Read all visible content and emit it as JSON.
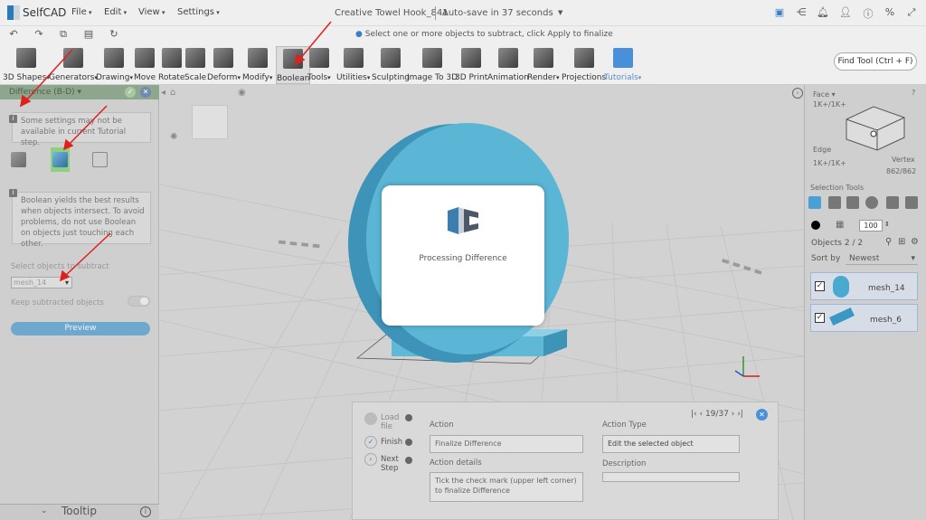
{
  "app": {
    "name": "SelfCAD"
  },
  "menu": [
    {
      "label": "File"
    },
    {
      "label": "Edit"
    },
    {
      "label": "View"
    },
    {
      "label": "Settings"
    }
  ],
  "project": {
    "title": "Creative Towel Hook_841",
    "autosave": "Auto-save in 37 seconds"
  },
  "hint": "Select one or more objects to subtract, click Apply to finalize",
  "toolbar": [
    {
      "label": "3D Shapes",
      "drop": true
    },
    {
      "label": "Generators",
      "drop": true
    },
    {
      "label": "Drawing",
      "drop": true
    },
    {
      "label": "Move"
    },
    {
      "label": "Rotate"
    },
    {
      "label": "Scale"
    },
    {
      "label": "Deform",
      "drop": true
    },
    {
      "label": "Modify",
      "drop": true
    },
    {
      "label": "Boolean"
    },
    {
      "label": "Tools",
      "drop": true
    },
    {
      "label": "Utilities",
      "drop": true
    },
    {
      "label": "Sculpting"
    },
    {
      "label": "Image To 3D"
    },
    {
      "label": "3D Print"
    },
    {
      "label": "Animation"
    },
    {
      "label": "Render",
      "drop": true
    },
    {
      "label": "Projections"
    },
    {
      "label": "Tutorials",
      "drop": true
    }
  ],
  "find_tool": "Find Tool (Ctrl + F)",
  "left_panel": {
    "title": "Difference (B-D)",
    "note1": "Some settings may not be available in current Tutorial step.",
    "note2": "Boolean yields the best results when objects intersect. To avoid problems, do not use Boolean on objects just touching each other.",
    "select_label": "Select objects to subtract",
    "select_value": "mesh_14",
    "keep_label": "Keep subtracted objects",
    "keep_value": false,
    "preview": "Preview",
    "tooltip": "Tooltip"
  },
  "modal": {
    "text": "Processing Difference"
  },
  "right_panel": {
    "face": "Face",
    "face_keys": "1K+/1K+",
    "edge": "Edge",
    "edge_keys": "1K+/1K+",
    "vertex": "Vertex",
    "vertex_count": "862/862",
    "selection_tools": "Selection Tools",
    "size": "100",
    "objects": "Objects 2 / 2",
    "sort_label": "Sort by",
    "sort_value": "Newest",
    "items": [
      {
        "name": "mesh_14",
        "checked": true
      },
      {
        "name": "mesh_6",
        "checked": true
      }
    ]
  },
  "tutorial": {
    "steps": [
      "Load file",
      "Finish",
      "Next Step"
    ],
    "pager": "19/37",
    "action_label": "Action",
    "action_value": "Finalize Difference",
    "details_label": "Action details",
    "details_value": "Tick the check mark (upper left corner) to finalize Difference",
    "type_label": "Action Type",
    "type_value": "Edit the selected object",
    "desc_label": "Description",
    "desc_value": ""
  },
  "colors": {
    "accent": "#4aa3c5",
    "header_green": "#8ea58e",
    "annot_red": "#e0201c"
  }
}
